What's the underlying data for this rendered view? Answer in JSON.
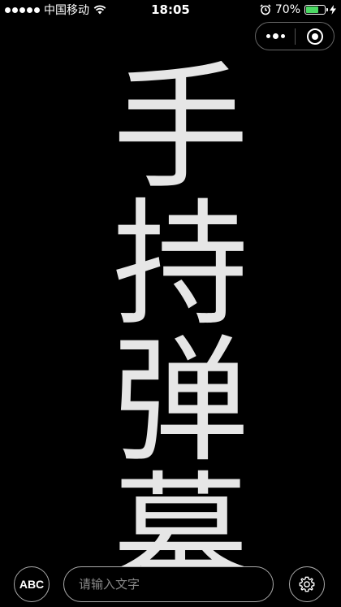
{
  "status_bar": {
    "carrier": "中国移动",
    "time": "18:05",
    "battery_percent": "70%",
    "battery_level": 0.7,
    "icons": [
      "signal-dots-icon",
      "wifi-icon",
      "alarm-icon",
      "battery-icon",
      "charging-icon"
    ]
  },
  "capsule": {
    "more_icon": "more-dots-icon",
    "close_icon": "target-close-icon"
  },
  "marquee": {
    "text": "手持弹幕"
  },
  "bottom_bar": {
    "abc_label": "ABC",
    "input_value": "",
    "input_placeholder": "请输入文字",
    "settings_icon": "gear-icon"
  },
  "colors": {
    "background": "#000000",
    "marquee_text": "#e6e6e6",
    "battery_fill": "#4cd964",
    "border": "#aaaaaa"
  }
}
